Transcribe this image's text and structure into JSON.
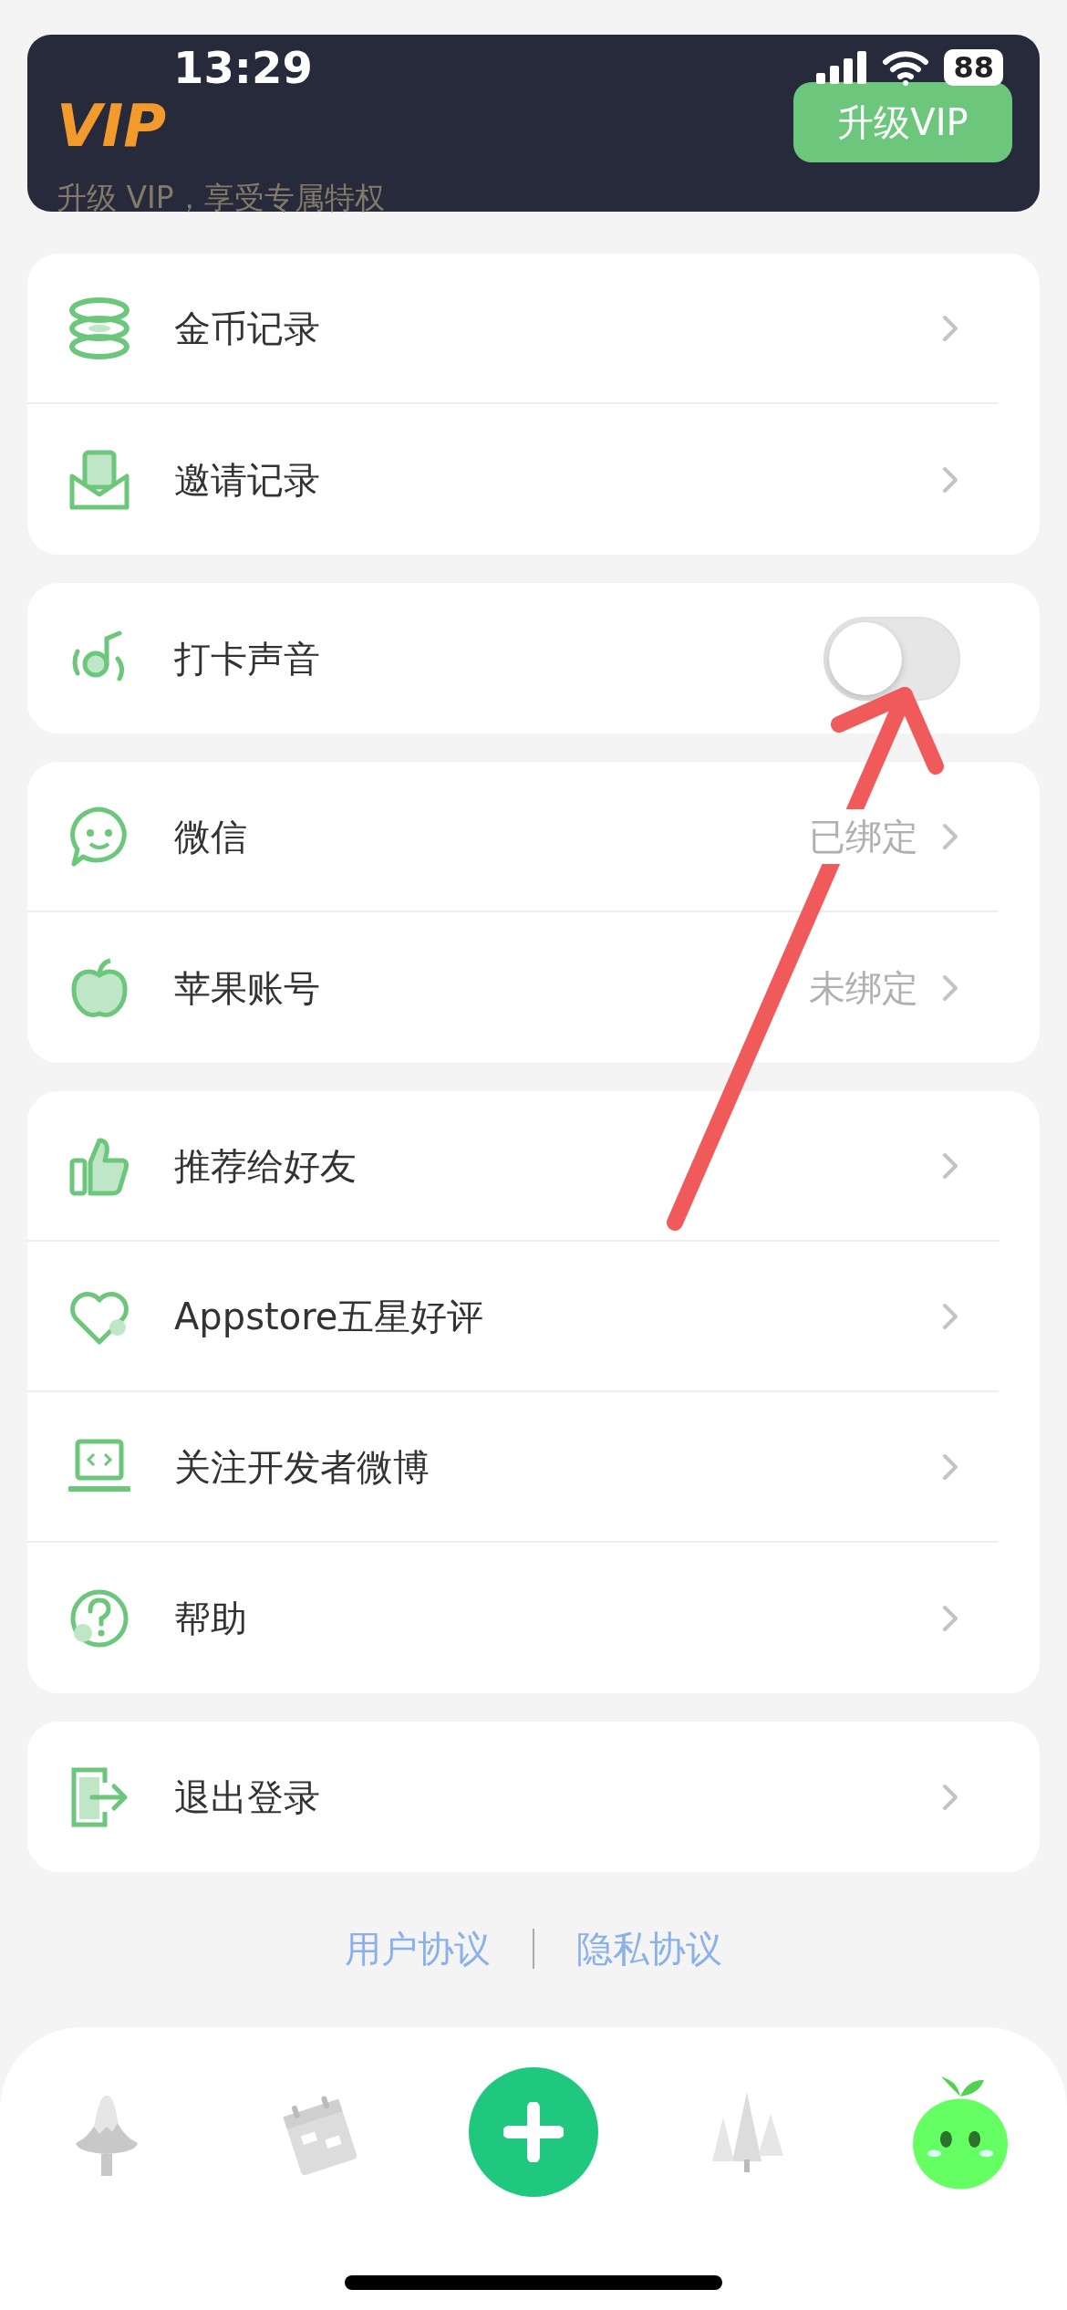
{
  "status_bar": {
    "time": "13:29",
    "battery": "88"
  },
  "vip_banner": {
    "logo": "VIP",
    "subtitle": "升级 VIP，享受专属特权",
    "button": "升级VIP"
  },
  "groups": [
    {
      "items": [
        {
          "kind": "link",
          "label": "金币记录"
        },
        {
          "kind": "link",
          "label": "邀请记录"
        }
      ]
    },
    {
      "items": [
        {
          "kind": "toggle",
          "label": "打卡声音",
          "on": false
        }
      ]
    },
    {
      "items": [
        {
          "kind": "link",
          "label": "微信",
          "value": "已绑定"
        },
        {
          "kind": "link",
          "label": "苹果账号",
          "value": "未绑定"
        }
      ]
    },
    {
      "items": [
        {
          "kind": "link",
          "label": "推荐给好友"
        },
        {
          "kind": "link",
          "label": "Appstore五星好评"
        },
        {
          "kind": "link",
          "label": "关注开发者微博"
        },
        {
          "kind": "link",
          "label": "帮助"
        }
      ]
    },
    {
      "items": [
        {
          "kind": "link",
          "label": "退出登录"
        }
      ]
    }
  ],
  "footer_links": [
    "用户协议",
    "隐私协议"
  ],
  "tab_bar": {
    "tabs": [
      {
        "kind": "tab",
        "selected": false
      },
      {
        "kind": "tab",
        "selected": false
      },
      {
        "kind": "add",
        "selected": false
      },
      {
        "kind": "tab",
        "selected": false
      },
      {
        "kind": "tab",
        "selected": true
      }
    ]
  }
}
